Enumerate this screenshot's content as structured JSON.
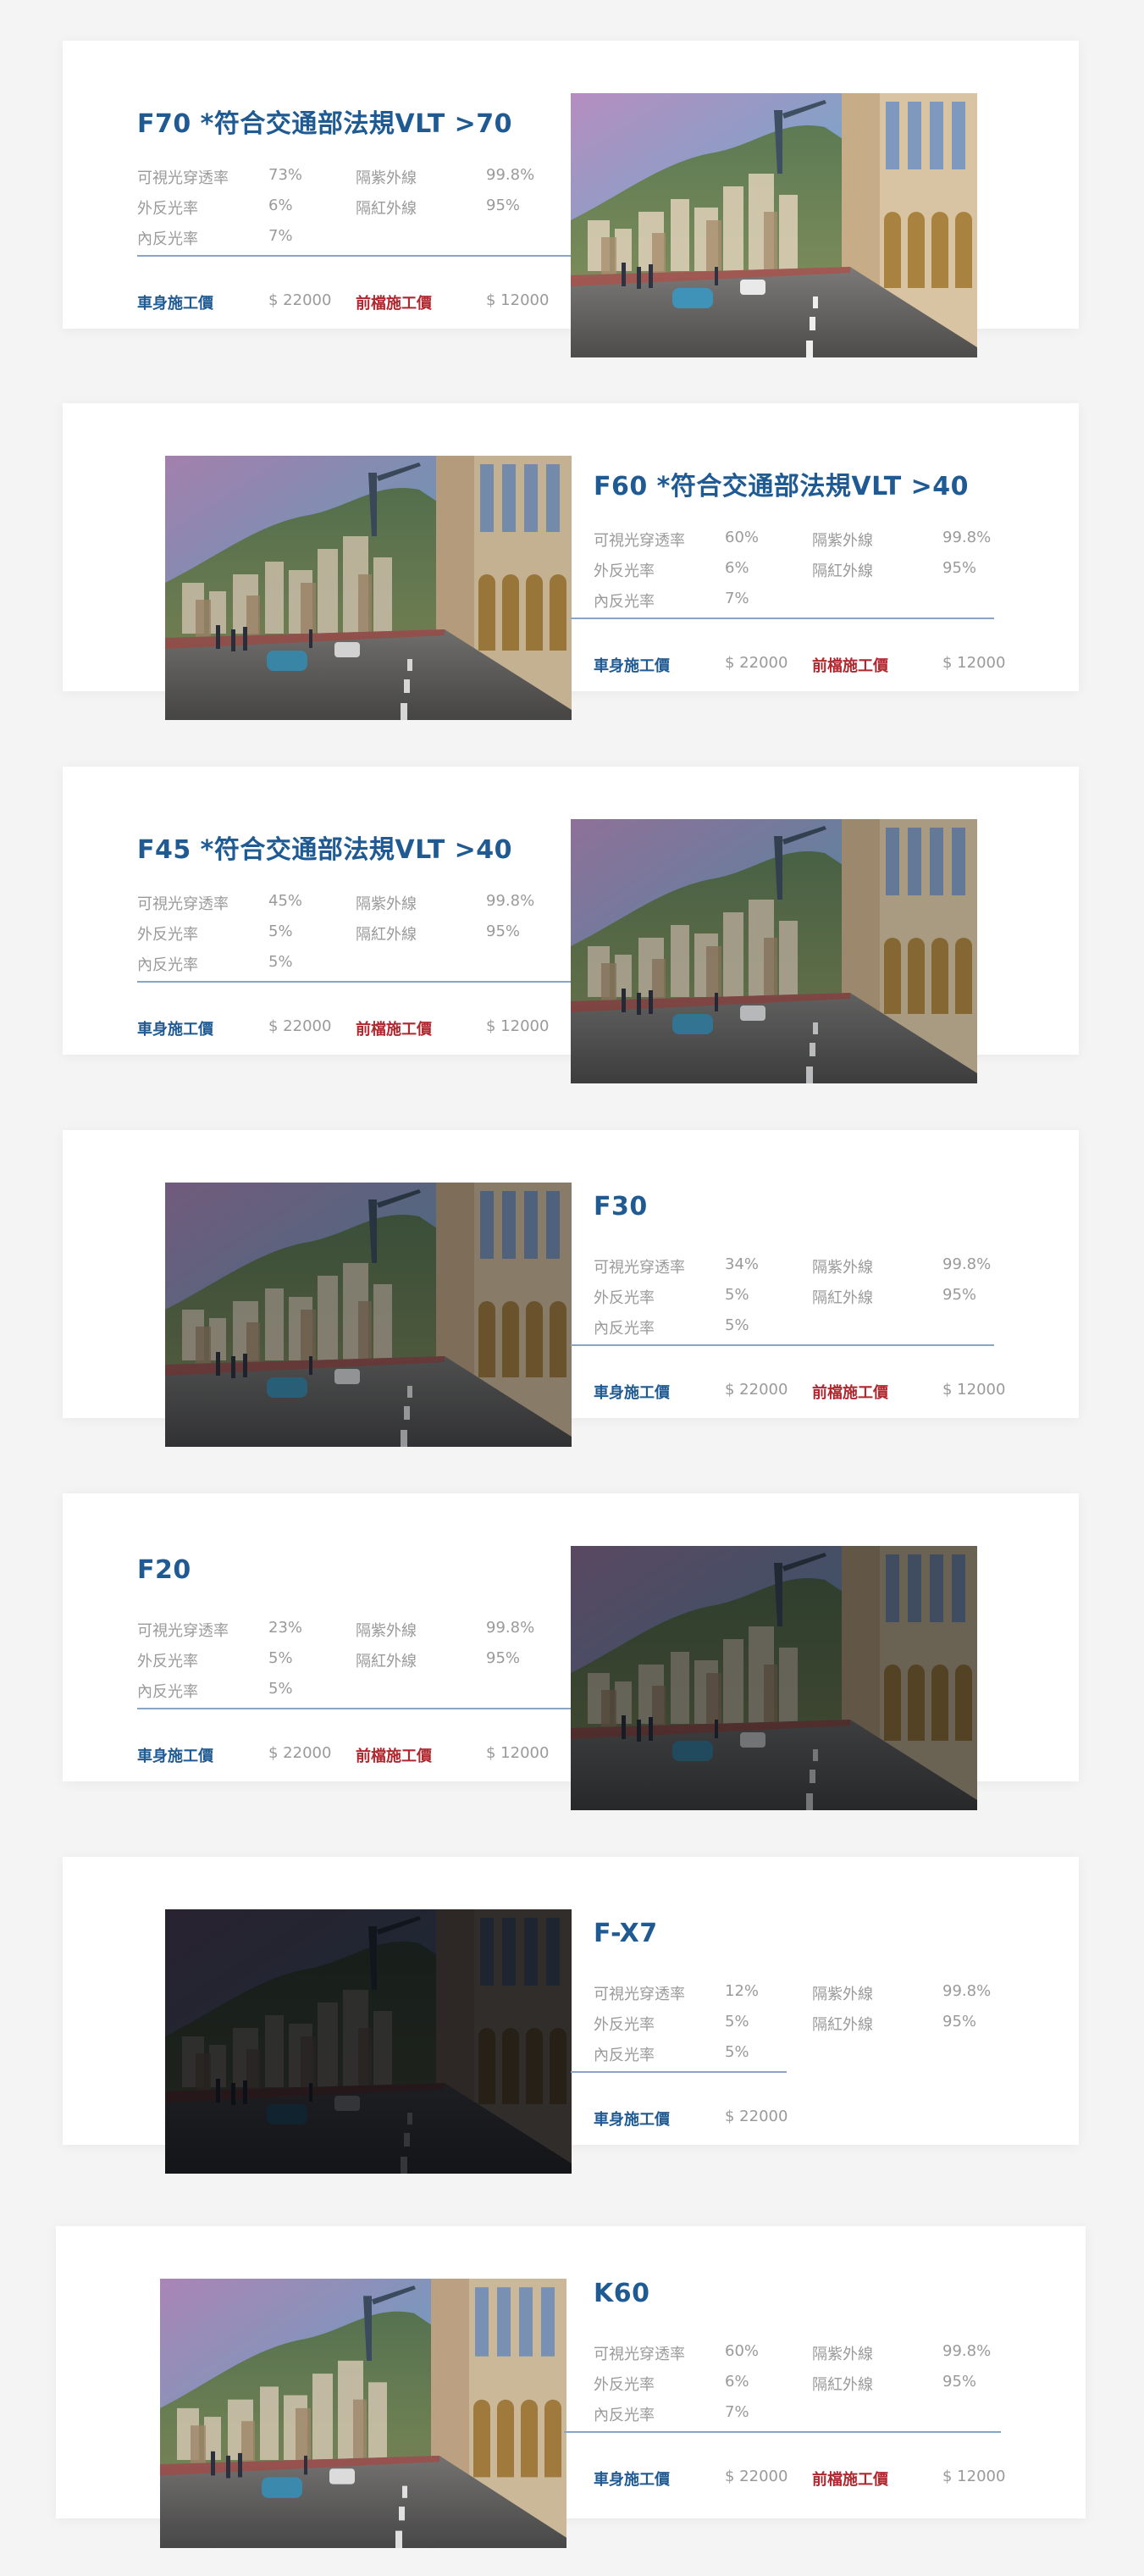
{
  "products": [
    {
      "title": "F70 *符合交通部法規VLT >70",
      "specs": [
        {
          "label": "可視光穿透率",
          "value": "73%"
        },
        {
          "label": "外反光率",
          "value": "6%"
        },
        {
          "label": "內反光率",
          "value": "7%"
        },
        {
          "label": "隔紫外線",
          "value": "99.8%"
        },
        {
          "label": "隔紅外線",
          "value": "95%"
        }
      ],
      "body_price_label": "車身施工價",
      "body_price": "$ 22000",
      "front_price_label": "前檔施工價",
      "front_price": "$ 12000",
      "tint_darkness": 0.0
    },
    {
      "title": "F60 *符合交通部法規VLT >40",
      "specs": [
        {
          "label": "可視光穿透率",
          "value": "60%"
        },
        {
          "label": "外反光率",
          "value": "6%"
        },
        {
          "label": "內反光率",
          "value": "7%"
        },
        {
          "label": "隔紫外線",
          "value": "99.8%"
        },
        {
          "label": "隔紅外線",
          "value": "95%"
        }
      ],
      "body_price_label": "車身施工價",
      "body_price": "$ 22000",
      "front_price_label": "前檔施工價",
      "front_price": "$ 12000",
      "tint_darkness": 0.1
    },
    {
      "title": "F45 *符合交通部法規VLT >40",
      "specs": [
        {
          "label": "可視光穿透率",
          "value": "45%"
        },
        {
          "label": "外反光率",
          "value": "5%"
        },
        {
          "label": "內反光率",
          "value": "5%"
        },
        {
          "label": "隔紫外線",
          "value": "99.8%"
        },
        {
          "label": "隔紅外線",
          "value": "95%"
        }
      ],
      "body_price_label": "車身施工價",
      "body_price": "$ 22000",
      "front_price_label": "前檔施工價",
      "front_price": "$ 12000",
      "tint_darkness": 0.22
    },
    {
      "title": "F30",
      "specs": [
        {
          "label": "可視光穿透率",
          "value": "34%"
        },
        {
          "label": "外反光率",
          "value": "5%"
        },
        {
          "label": "內反光率",
          "value": "5%"
        },
        {
          "label": "隔紫外線",
          "value": "99.8%"
        },
        {
          "label": "隔紅外線",
          "value": "95%"
        }
      ],
      "body_price_label": "車身施工價",
      "body_price": "$ 22000",
      "front_price_label": "前檔施工價",
      "front_price": "$ 12000",
      "tint_darkness": 0.38
    },
    {
      "title": "F20",
      "specs": [
        {
          "label": "可視光穿透率",
          "value": "23%"
        },
        {
          "label": "外反光率",
          "value": "5%"
        },
        {
          "label": "內反光率",
          "value": "5%"
        },
        {
          "label": "隔紫外線",
          "value": "99.8%"
        },
        {
          "label": "隔紅外線",
          "value": "95%"
        }
      ],
      "body_price_label": "車身施工價",
      "body_price": "$ 22000",
      "front_price_label": "前檔施工價",
      "front_price": "$ 12000",
      "tint_darkness": 0.52
    },
    {
      "title": "F-X7",
      "specs": [
        {
          "label": "可視光穿透率",
          "value": "12%"
        },
        {
          "label": "外反光率",
          "value": "5%"
        },
        {
          "label": "內反光率",
          "value": "5%"
        },
        {
          "label": "隔紫外線",
          "value": "99.8%"
        },
        {
          "label": "隔紅外線",
          "value": "95%"
        }
      ],
      "body_price_label": "車身施工價",
      "body_price": "$ 22000",
      "front_price_label": "",
      "front_price": "",
      "tint_darkness": 0.8
    },
    {
      "title": "K60",
      "specs": [
        {
          "label": "可視光穿透率",
          "value": "60%"
        },
        {
          "label": "外反光率",
          "value": "6%"
        },
        {
          "label": "內反光率",
          "value": "7%"
        },
        {
          "label": "隔紫外線",
          "value": "99.8%"
        },
        {
          "label": "隔紅外線",
          "value": "95%"
        }
      ],
      "body_price_label": "車身施工價",
      "body_price": "$ 22000",
      "front_price_label": "前檔施工價",
      "front_price": "$ 12000",
      "tint_darkness": 0.06
    }
  ]
}
